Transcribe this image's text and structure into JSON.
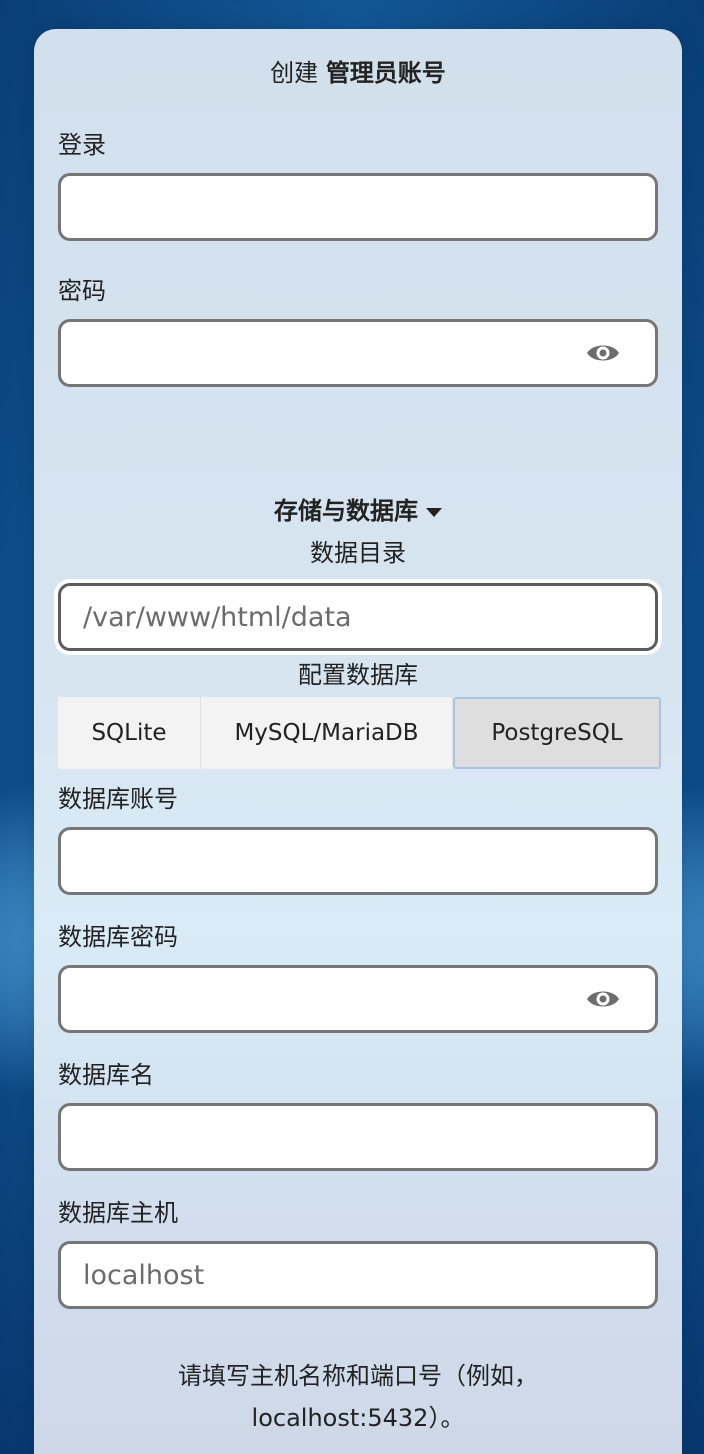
{
  "admin": {
    "heading_prefix": "创建",
    "heading_bold": "管理员账号",
    "login_label": "登录",
    "login_value": "",
    "password_label": "密码",
    "password_value": ""
  },
  "storage": {
    "section_title": "存储与数据库",
    "data_dir_label": "数据目录",
    "data_dir_placeholder": "/var/www/html/data",
    "config_db_label": "配置数据库",
    "db_tabs": [
      "SQLite",
      "MySQL/MariaDB",
      "PostgreSQL"
    ],
    "selected_tab": "PostgreSQL",
    "db_user_label": "数据库账号",
    "db_password_label": "数据库密码",
    "db_name_label": "数据库名",
    "db_host_label": "数据库主机",
    "db_host_placeholder": "localhost",
    "hint_line1": "请填写主机名称和端口号（例如，",
    "hint_line2": "localhost:5432）。"
  },
  "icons": {
    "password_toggle": "eye-icon",
    "section_toggle": "caret-down-icon"
  }
}
